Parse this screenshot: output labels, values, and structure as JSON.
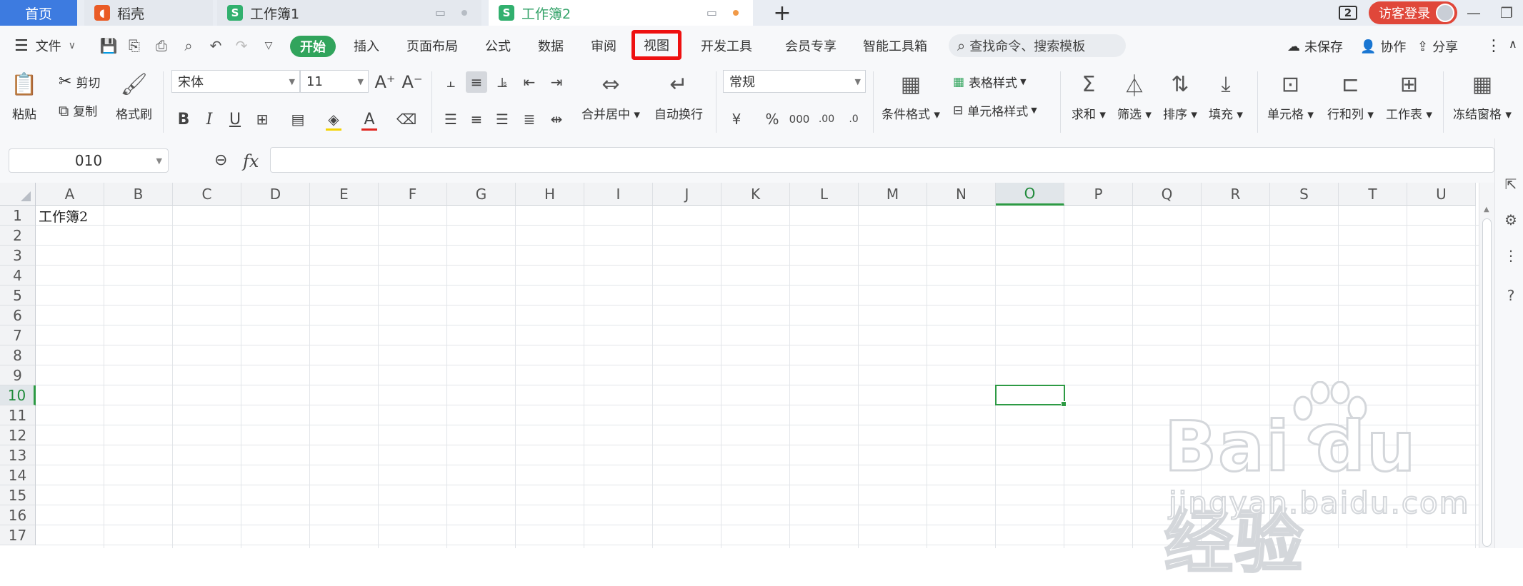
{
  "tabs": {
    "home": "首页",
    "daoke": "稻壳",
    "book1": "工作簿1",
    "book2": "工作簿2",
    "new_tab": "+",
    "window_count": "2",
    "login": "访客登录"
  },
  "menu": {
    "file": "文件",
    "start": "开始",
    "insert": "插入",
    "page_layout": "页面布局",
    "formula": "公式",
    "data": "数据",
    "review": "审阅",
    "view": "视图",
    "dev_tools": "开发工具",
    "member": "会员专享",
    "smart_tools": "智能工具箱",
    "search_placeholder": "查找命令、搜索模板",
    "unsaved": "未保存",
    "collab": "协作",
    "share": "分享"
  },
  "ribbon": {
    "paste": "粘贴",
    "cut": "剪切",
    "copy": "复制",
    "format_painter": "格式刷",
    "font_name": "宋体",
    "font_size": "11",
    "merge_center": "合并居中",
    "wrap_text": "自动换行",
    "number_format": "常规",
    "cond_format": "条件格式",
    "table_style": "表格样式",
    "cell_style": "单元格样式",
    "sum": "求和",
    "filter": "筛选",
    "sort": "排序",
    "fill": "填充",
    "cell": "单元格",
    "row_col": "行和列",
    "worksheet": "工作表",
    "freeze": "冻结窗格"
  },
  "formula_bar": {
    "name_box": "010",
    "fx": "fx",
    "content": ""
  },
  "sheet": {
    "columns": [
      "A",
      "B",
      "C",
      "D",
      "E",
      "F",
      "G",
      "H",
      "I",
      "J",
      "K",
      "L",
      "M",
      "N",
      "O",
      "P",
      "Q",
      "R",
      "S",
      "T",
      "U"
    ],
    "rows": [
      "1",
      "2",
      "3",
      "4",
      "5",
      "6",
      "7",
      "8",
      "9",
      "10",
      "11",
      "12",
      "13",
      "14",
      "15",
      "16",
      "17"
    ],
    "active_column": "O",
    "active_row": "10",
    "cell_A1": "工作簿2"
  },
  "watermark": {
    "brand": "Bai du 经验",
    "url": "jingyan.baidu.com"
  },
  "colors": {
    "accent_blue": "#3d7be0",
    "accent_green": "#31a45c",
    "highlight_red": "#ee1010",
    "login_red": "#e0473a"
  }
}
